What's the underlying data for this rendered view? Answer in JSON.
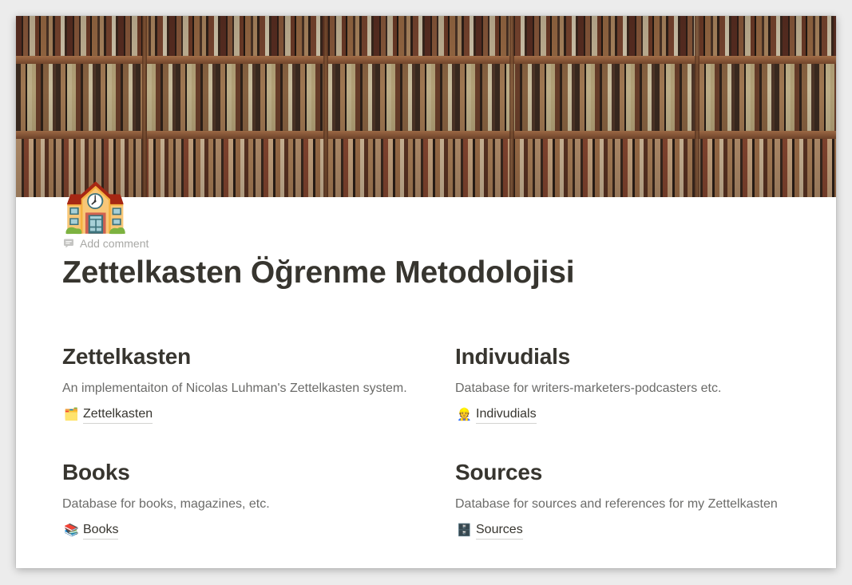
{
  "cover": {
    "image_name": "library-bookshelf-cover"
  },
  "page": {
    "icon_emoji": "🏫",
    "icon_name": "school-building-icon",
    "add_comment_label": "Add comment",
    "title": "Zettelkasten Öğrenme Metodolojisi"
  },
  "sections": [
    {
      "heading": "Zettelkasten",
      "description": "An implementaiton of Nicolas Luhman's Zettelkasten system.",
      "link_emoji": "🗂️",
      "link_icon_name": "card-index-dividers-icon",
      "link_label": "Zettelkasten"
    },
    {
      "heading": "Indivudials",
      "description": "Database for writers-marketers-podcasters etc.",
      "link_emoji": "👷",
      "link_icon_name": "person-icon",
      "link_label": "Indivudials"
    },
    {
      "heading": "Books",
      "description": "Database for books, magazines, etc.",
      "link_emoji": "📚",
      "link_icon_name": "books-icon",
      "link_label": "Books"
    },
    {
      "heading": "Sources",
      "description": "Database for sources and references for my Zettelkasten",
      "link_emoji": "🗄️",
      "link_icon_name": "file-cabinet-icon",
      "link_label": "Sources"
    }
  ],
  "colors": {
    "text": "#37352f",
    "muted": "#6b6b69",
    "placeholder": "#a8a8a5"
  }
}
